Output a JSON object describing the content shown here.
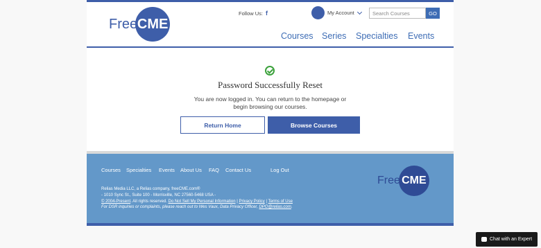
{
  "header": {
    "logo": {
      "free": "Free",
      "cme": "CME"
    },
    "follow_us": "Follow Us:",
    "facebook_glyph": "f",
    "account_label": "My Account",
    "search_placeholder": "Search Courses",
    "search_button": "GO",
    "nav": [
      "Courses",
      "Series",
      "Specialties",
      "Events"
    ]
  },
  "main": {
    "title": "Password Successfully Reset",
    "message_line1": "You are now logged in. You can return to the homepage or",
    "message_line2": "begin browsing our courses.",
    "return_home": "Return Home",
    "browse_courses": "Browse Courses",
    "success_color": "#3ba13b"
  },
  "footer": {
    "links": [
      "Courses",
      "Specialties",
      "Events",
      "About Us",
      "FAQ",
      "Contact Us",
      "Log Out"
    ],
    "company_line": "Relias Media LLC, a Relias company, freeCME.com®",
    "address_line": "- 1010 Sync St., Suite 100 - Morrisville, NC 27560-5468 USA -",
    "copyright": "© 2004-Present",
    "rights": ". All rights reserved.",
    "do_not_sell": "Do Not Sell My Personal Information",
    "sep1": "|",
    "privacy": "Privacy Policy",
    "sep2": "|",
    "terms": "Terms of Use",
    "dsr_line": "For DSR inquiries or complaints, please reach out to Wes Vaux, Data Privacy Officer,",
    "dpo_email": "DPO@relias.com",
    "logo": {
      "free": "Free",
      "cme": "CME"
    }
  },
  "chat": {
    "label": "Chat with an Expert"
  },
  "colors": {
    "brand": "#3e5ea9",
    "footer_bg": "#6398c9",
    "link_blue": "#3e6db5"
  }
}
